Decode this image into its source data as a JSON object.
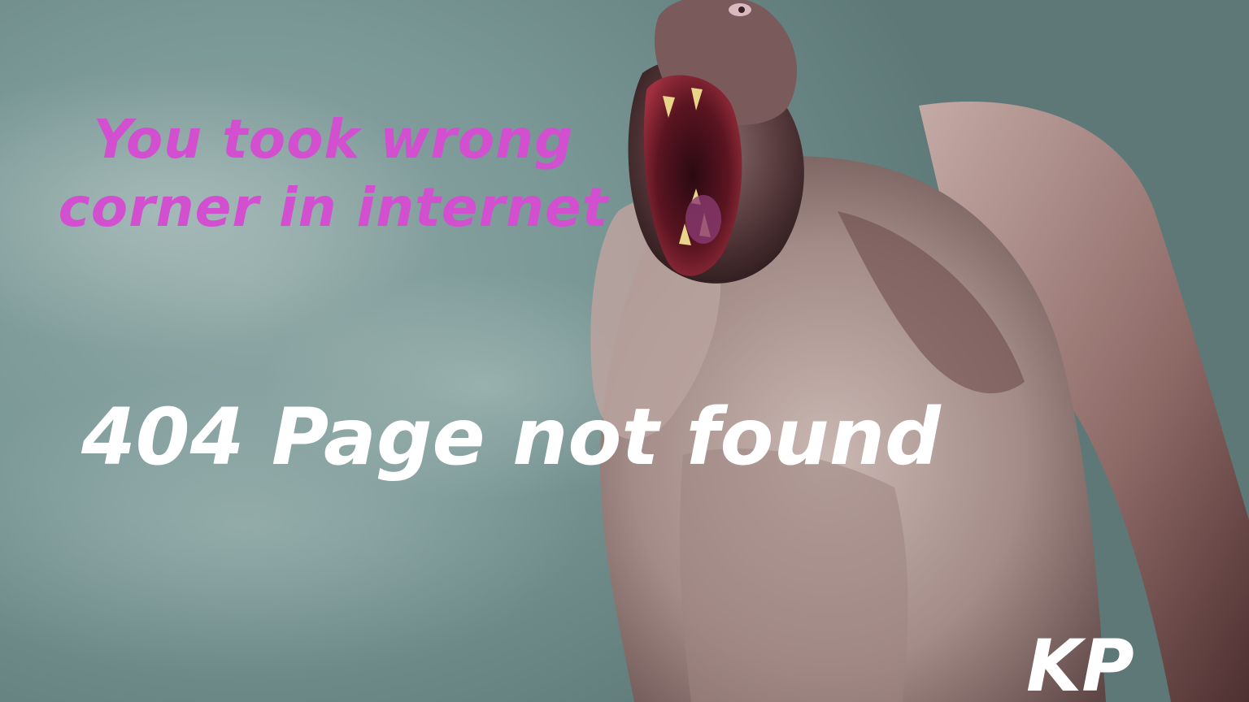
{
  "message": {
    "tagline_line1": "You took wrong",
    "tagline_line2": "corner in internet",
    "headline": "404 Page not found",
    "signature": "KP"
  },
  "colors": {
    "tagline": "#d24fd0",
    "headline": "#ffffff",
    "background": "#7a9896"
  }
}
